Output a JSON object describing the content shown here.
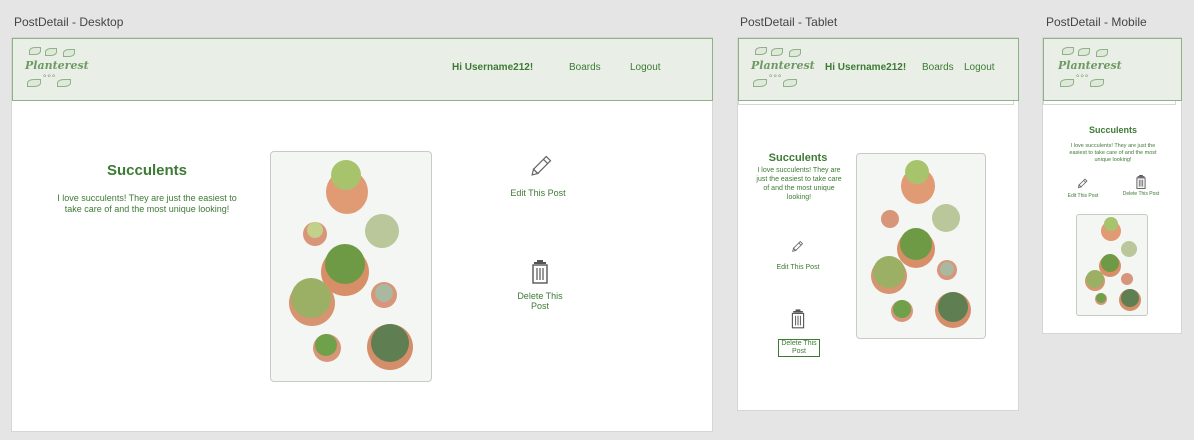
{
  "frames": {
    "desktop": {
      "label": "PostDetail - Desktop"
    },
    "tablet": {
      "label": "PostDetail - Tablet"
    },
    "mobile": {
      "label": "PostDetail - Mobile"
    }
  },
  "brand": {
    "logo_text": "Planterest",
    "logo_dots": "✿ ✿ ✿"
  },
  "nav": {
    "greeting": "Hi Username212!",
    "boards": "Boards",
    "logout": "Logout"
  },
  "post": {
    "title": "Succulents",
    "description": "I love succulents! They are just the easiest to take care of and the most unique looking!",
    "edit_label": "Edit This Post",
    "delete_label": "Delete This Post"
  },
  "colors": {
    "accent": "#3d7a34",
    "navbar_bg": "#e9efe6",
    "navbar_border": "#8fb186"
  },
  "icons": {
    "edit": "pencil-icon",
    "delete": "trash-icon"
  }
}
